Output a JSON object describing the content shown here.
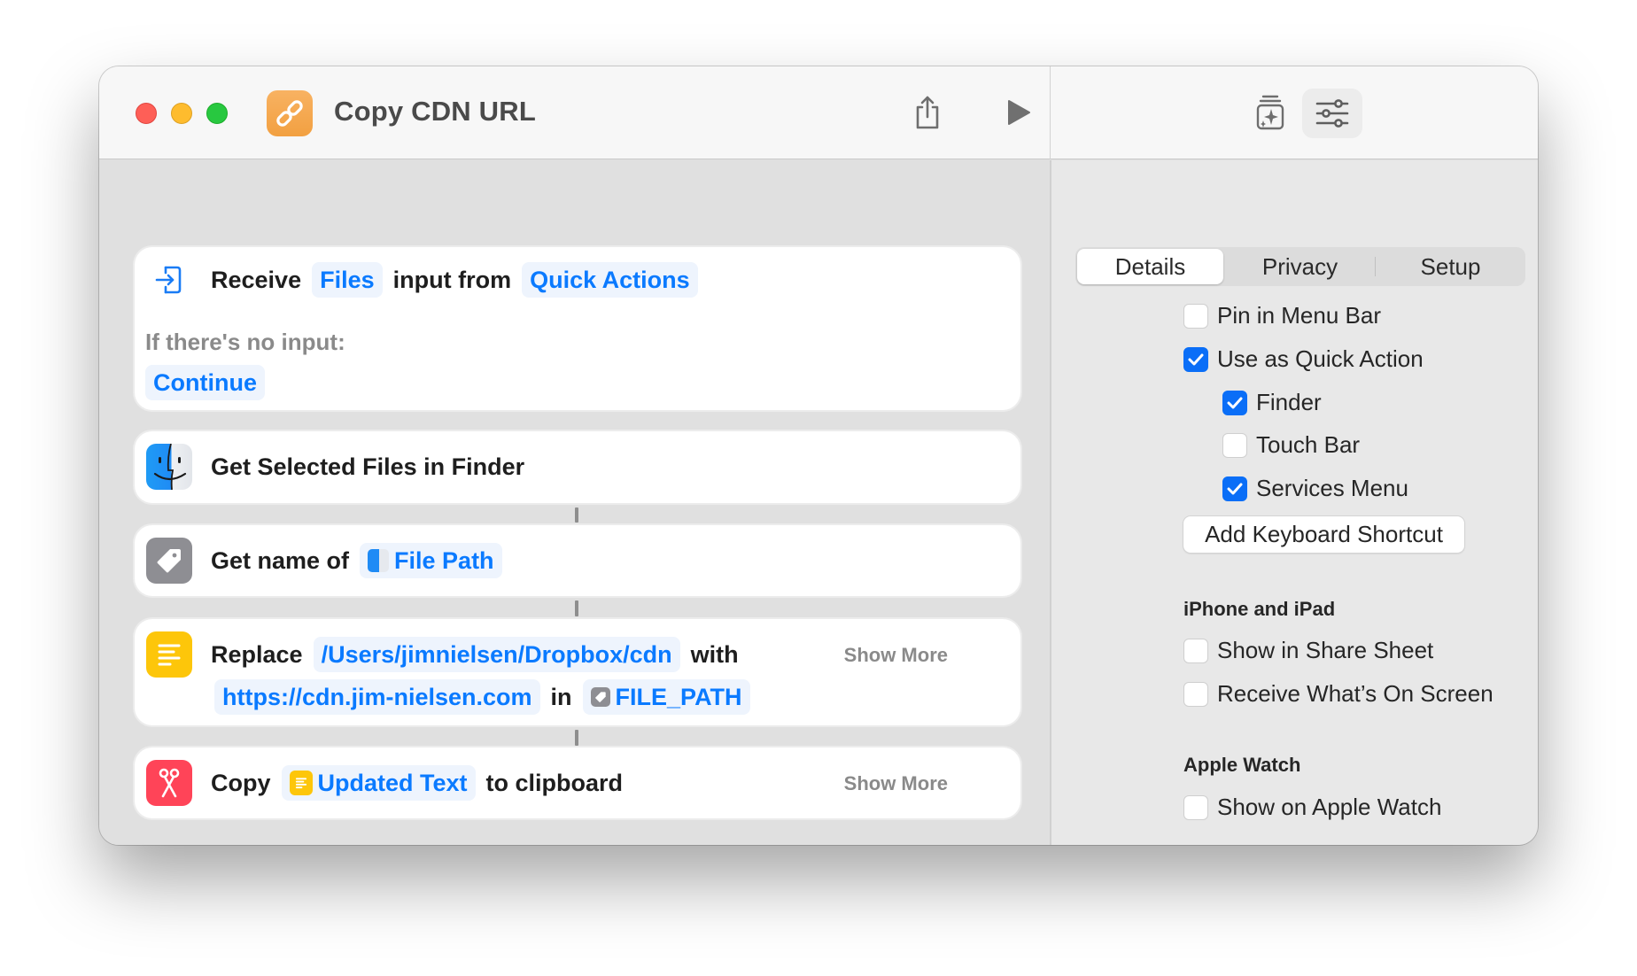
{
  "window": {
    "title": "Copy CDN URL",
    "icon": "link-icon",
    "accent_color": "#f5a54b"
  },
  "toolbar": {
    "traffic_lights": [
      "close",
      "minimize",
      "zoom"
    ],
    "share_icon": "share-icon",
    "run_icon": "play-icon",
    "gallery_icon": "action-library-icon",
    "settings_icon": "sliders-icon"
  },
  "actions": [
    {
      "type": "receive",
      "icon": "input-arrow-icon",
      "verb": "Receive",
      "input_type": "Files",
      "middle": "input from",
      "source": "Quick Actions",
      "no_input_label": "If there's no input:",
      "no_input_action": "Continue"
    },
    {
      "type": "finder",
      "icon": "finder-icon",
      "text": "Get Selected Files in Finder"
    },
    {
      "type": "get-name",
      "icon": "tag-icon",
      "text": "Get name of",
      "variable": "File Path",
      "variable_icon": "finder-icon"
    },
    {
      "type": "replace",
      "icon": "text-icon",
      "verb": "Replace",
      "find": "/Users/jimnielsen/Dropbox/cdn",
      "with_label": "with",
      "replacement": "https://cdn.jim-nielsen.com",
      "in_label": "in",
      "target": "FILE_PATH",
      "target_icon": "tag-icon",
      "show_more": "Show More"
    },
    {
      "type": "copy",
      "icon": "scissors-icon",
      "verb": "Copy",
      "variable": "Updated Text",
      "variable_icon": "text-icon",
      "suffix": "to clipboard",
      "show_more": "Show More"
    }
  ],
  "inspector": {
    "tabs": [
      {
        "label": "Details",
        "active": true
      },
      {
        "label": "Privacy",
        "active": false
      },
      {
        "label": "Setup",
        "active": false
      }
    ],
    "options": [
      {
        "label": "Pin in Menu Bar",
        "checked": false
      },
      {
        "label": "Use as Quick Action",
        "checked": true
      },
      {
        "label": "Finder",
        "checked": true
      },
      {
        "label": "Touch Bar",
        "checked": false
      },
      {
        "label": "Services Menu",
        "checked": true
      }
    ],
    "keyboard_shortcut_button": "Add Keyboard Shortcut",
    "iphone_section": {
      "title": "iPhone and iPad",
      "options": [
        {
          "label": "Show in Share Sheet",
          "checked": false
        },
        {
          "label": "Receive What’s On Screen",
          "checked": false
        }
      ]
    },
    "watch_section": {
      "title": "Apple Watch",
      "options": [
        {
          "label": "Show on Apple Watch",
          "checked": false
        }
      ]
    }
  }
}
